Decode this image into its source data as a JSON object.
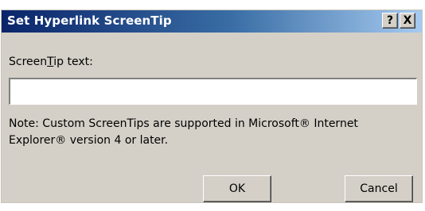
{
  "window": {
    "title": "Set Hyperlink ScreenTip",
    "help_label": "?",
    "close_label": "X"
  },
  "form": {
    "label_before": "Screen",
    "label_hotkey": "T",
    "label_after": "ip text:",
    "value": "",
    "note": "Note: Custom ScreenTips are supported in Microsoft® Internet Explorer® version 4 or later."
  },
  "buttons": {
    "ok_label": "OK",
    "cancel_label": "Cancel"
  },
  "colors": {
    "titlebar_start": "#0a246a",
    "titlebar_end": "#a6caf0",
    "face": "#d4d0c8"
  }
}
